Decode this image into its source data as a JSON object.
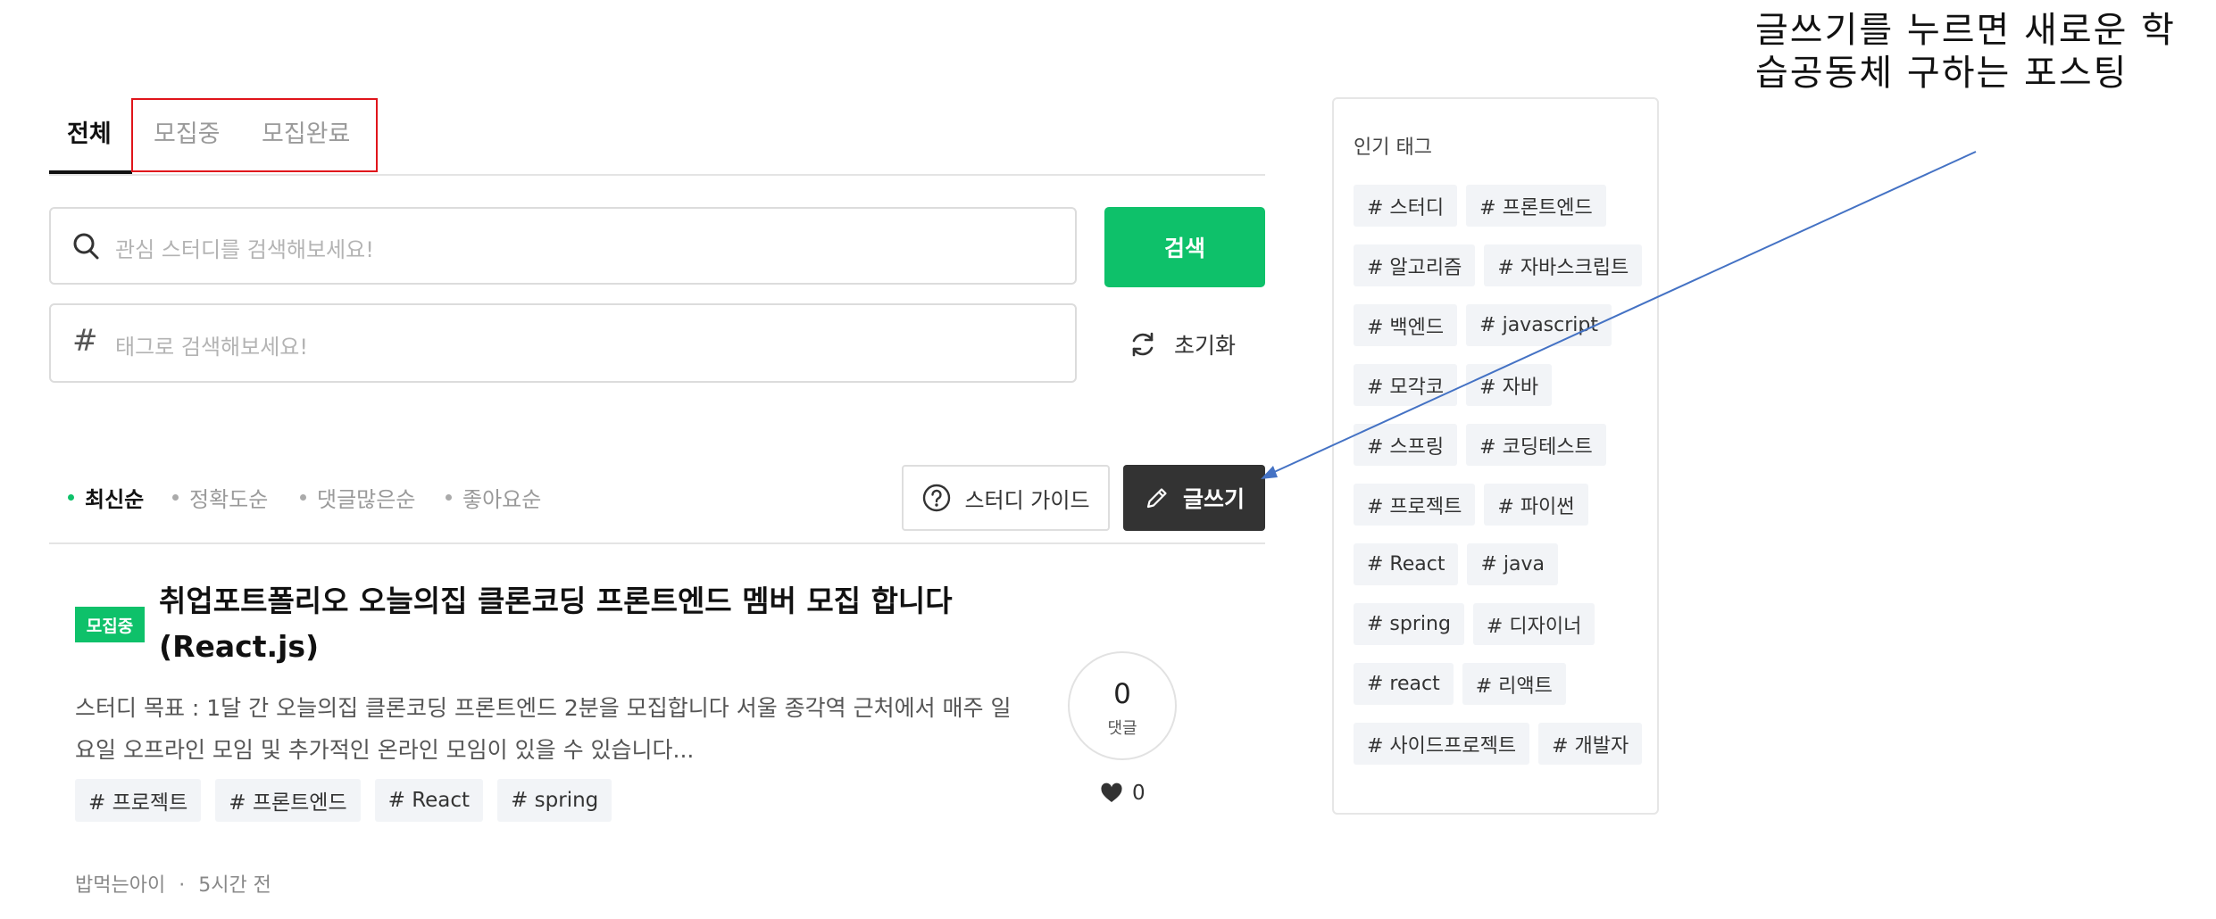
{
  "tabs": [
    {
      "label": "전체",
      "active": true
    },
    {
      "label": "모집중",
      "active": false
    },
    {
      "label": "모집완료",
      "active": false
    }
  ],
  "search": {
    "placeholder": "관심 스터디를 검색해보세요!",
    "button_label": "검색",
    "tag_placeholder": "태그로 검색해보세요!",
    "reset_label": "초기화"
  },
  "sort_options": [
    {
      "label": "최신순",
      "active": true
    },
    {
      "label": "정확도순",
      "active": false
    },
    {
      "label": "댓글많은순",
      "active": false
    },
    {
      "label": "좋아요순",
      "active": false
    }
  ],
  "actions": {
    "guide_label": "스터디 가이드",
    "write_label": "글쓰기"
  },
  "post": {
    "badge": "모집중",
    "title": "취업포트폴리오 오늘의집 클론코딩 프론트엔드 멤버 모집 합니다 (React.js)",
    "description": " 스터디 목표 : 1달 간 오늘의집 클론코딩 프론트엔드 2분을 모집합니다 서울 종각역 근처에서 매주 일요일 오프라인 모임 및 추가적인 온라인 모임이 있을 수 있습니다...",
    "tags": [
      "# 프로젝트",
      "# 프론트엔드",
      "# React",
      "# spring"
    ],
    "comment_count": "0",
    "comment_label": "댓글",
    "like_count": "0",
    "author": "밥먹는아이",
    "separator": "·",
    "time": "5시간 전"
  },
  "popular": {
    "title": "인기 태그",
    "tags": [
      "# 스터디",
      "# 프론트엔드",
      "# 알고리즘",
      "# 자바스크립트",
      "# 백엔드",
      "# javascript",
      "# 모각코",
      "# 자바",
      "# 스프링",
      "# 코딩테스트",
      "# 프로젝트",
      "# 파이썬",
      "# React",
      "# java",
      "# spring",
      "# 디자이너",
      "# react",
      "# 리액트",
      "# 사이드프로젝트",
      "# 개발자"
    ]
  },
  "annotation": {
    "line1": "글쓰기를 누르면 새로운 학",
    "line2": "습공동체 구하는 포스팅"
  },
  "colors": {
    "accent_green": "#0ec16a",
    "dark_button": "#333333",
    "annotation_box": "#e0151b",
    "arrow": "#4472c4"
  }
}
